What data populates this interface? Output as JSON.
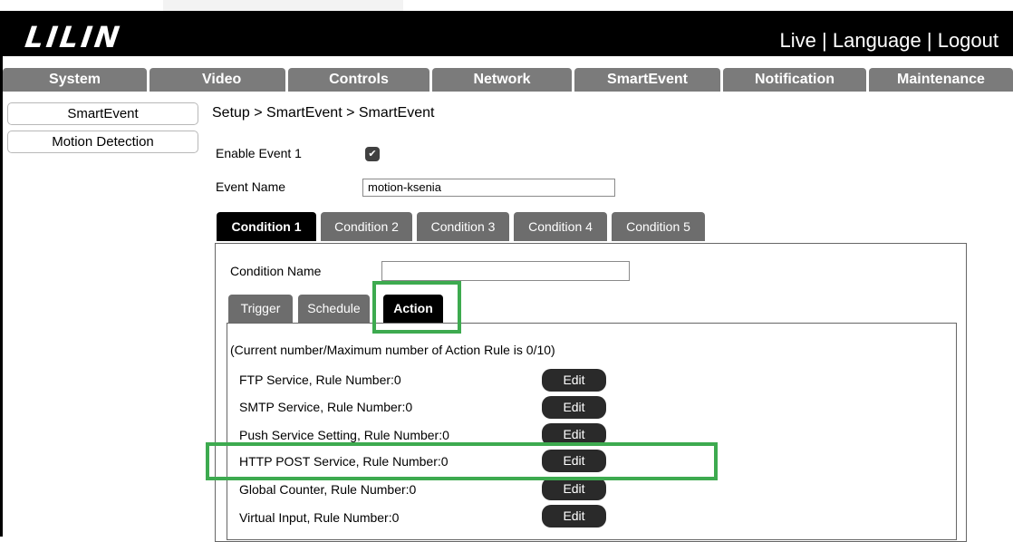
{
  "header": {
    "logo": "LILIN",
    "links": [
      "Live",
      "Language",
      "Logout"
    ],
    "separator": " | "
  },
  "nav": [
    "System",
    "Video",
    "Controls",
    "Network",
    "SmartEvent",
    "Notification",
    "Maintenance"
  ],
  "sidebar": {
    "items": [
      {
        "label": "SmartEvent"
      },
      {
        "label": "Motion Detection"
      }
    ]
  },
  "breadcrumb": "Setup > SmartEvent > SmartEvent",
  "form": {
    "enable_label": "Enable Event 1",
    "enable_checked": true,
    "event_name_label": "Event Name",
    "event_name_value": "motion-ksenia",
    "condition_name_label": "Condition Name",
    "condition_name_value": ""
  },
  "condition_tabs": [
    "Condition 1",
    "Condition 2",
    "Condition 3",
    "Condition 4",
    "Condition 5"
  ],
  "action_tabs": [
    "Trigger",
    "Schedule",
    "Action"
  ],
  "action": {
    "summary": "(Current number/Maximum number of Action Rule is 0/10)",
    "edit_label": "Edit",
    "rows": [
      {
        "label": "FTP Service, Rule Number:0"
      },
      {
        "label": "SMTP Service, Rule Number:0"
      },
      {
        "label": "Push Service Setting, Rule Number:0"
      },
      {
        "label": "HTTP POST Service, Rule Number:0"
      },
      {
        "label": "Global Counter, Rule Number:0"
      },
      {
        "label": "Virtual Input, Rule Number:0"
      }
    ]
  },
  "colors": {
    "header_bg": "#000000",
    "nav_bg": "#7b7b7b",
    "tab_active": "#000000",
    "tab_inactive": "#6d6d6d",
    "edit_button": "#2a2a2a",
    "highlight": "#3daa4f"
  }
}
